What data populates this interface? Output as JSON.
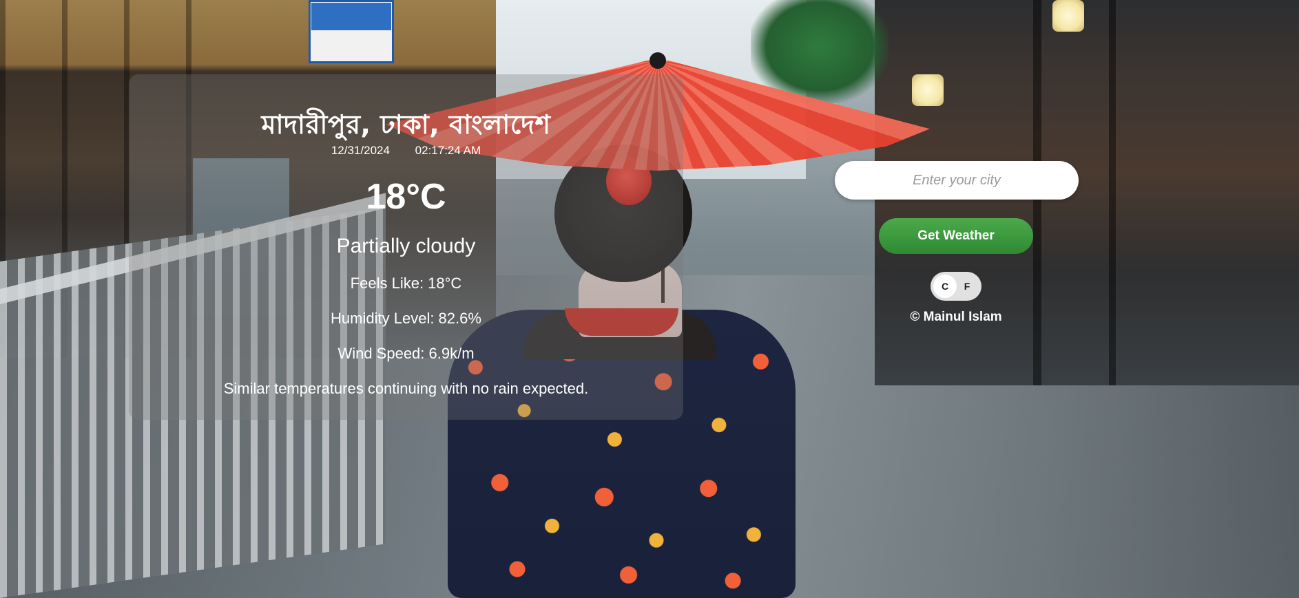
{
  "weather": {
    "location": "মাদারীপুর, ঢাকা, বাংলাদেশ",
    "date": "12/31/2024",
    "time": "02:17:24 AM",
    "temperature": "18°C",
    "condition": "Partially cloudy",
    "feels_like": "Feels Like: 18°C",
    "humidity": "Humidity Level: 82.6%",
    "wind_speed": "Wind Speed: 6.9k/m",
    "description": "Similar temperatures continuing with no rain expected."
  },
  "search": {
    "placeholder": "Enter your city",
    "button_label": "Get Weather"
  },
  "unit_toggle": {
    "celsius_label": "C",
    "fahrenheit_label": "F",
    "selected": "C"
  },
  "footer": {
    "credit": "© Mainul Islam"
  },
  "colors": {
    "button_green": "#3f9b3f",
    "card_overlay": "rgba(120,120,120,0.32)",
    "text": "#ffffff"
  }
}
